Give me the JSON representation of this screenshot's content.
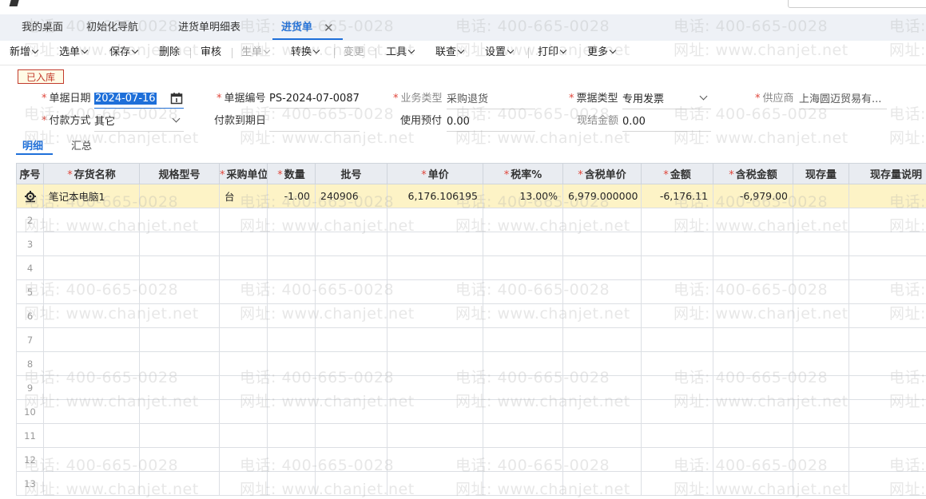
{
  "app": {
    "title_partial": "",
    "subtitle_partial": "",
    "date_partial": ""
  },
  "tabs": [
    {
      "label": "我的桌面"
    },
    {
      "label": "初始化导航"
    },
    {
      "label": "进货单明细表"
    },
    {
      "label": "进货单",
      "active": true
    }
  ],
  "toolbar": {
    "items": [
      {
        "label": "新增",
        "dropdown": true
      },
      {
        "label": "选单",
        "dropdown": true
      },
      {
        "label": "保存",
        "dropdown": true
      },
      {
        "label": "删除"
      },
      {
        "label": "审核"
      },
      {
        "label": "生单",
        "dropdown": true,
        "disabled": true
      },
      {
        "label": "转换",
        "dropdown": true
      },
      {
        "label": "变更",
        "disabled": true
      },
      {
        "label": "工具",
        "dropdown": true
      },
      {
        "label": "联查",
        "dropdown": true
      },
      {
        "label": "设置",
        "dropdown": true
      },
      {
        "label": "打印",
        "dropdown": true
      },
      {
        "label": "更多",
        "dropdown": true
      }
    ]
  },
  "status_badge": "已入库",
  "form": {
    "doc_date": {
      "label": "单据日期",
      "value": "2024-07-16"
    },
    "doc_no": {
      "label": "单据编号",
      "value": "PS-2024-07-0087"
    },
    "biz_type": {
      "label": "业务类型",
      "value": "采购退货"
    },
    "invoice_type": {
      "label": "票据类型",
      "value": "专用发票"
    },
    "supplier": {
      "label": "供应商",
      "value": "上海圆迈贸易有..."
    },
    "pay_method": {
      "label": "付款方式",
      "value": "其它"
    },
    "pay_due": {
      "label": "付款到期日",
      "value": ""
    },
    "prepay": {
      "label": "使用预付",
      "value": "0.00"
    },
    "cash_settle": {
      "label": "现结金额",
      "value": "0.00"
    }
  },
  "subtabs": [
    {
      "label": "明细",
      "active": true
    },
    {
      "label": "汇总"
    }
  ],
  "grid": {
    "columns": [
      {
        "label": "序号",
        "required": false
      },
      {
        "label": "存货名称",
        "required": true
      },
      {
        "label": "规格型号",
        "required": false
      },
      {
        "label": "采购单位",
        "required": true
      },
      {
        "label": "数量",
        "required": true
      },
      {
        "label": "批号",
        "required": false
      },
      {
        "label": "单价",
        "required": true
      },
      {
        "label": "税率%",
        "required": true
      },
      {
        "label": "含税单价",
        "required": true
      },
      {
        "label": "金额",
        "required": true
      },
      {
        "label": "含税金额",
        "required": true
      },
      {
        "label": "现存量",
        "required": false
      },
      {
        "label": "现存量说明",
        "required": false
      }
    ],
    "rows": [
      {
        "name": "笔记本电脑1",
        "spec": "",
        "unit": "台",
        "qty": "-1.00",
        "batch": "240906",
        "price": "6,176.106195",
        "tax_rate": "13.00%",
        "tax_price": "6,979.000000",
        "amount": "-6,176.11",
        "tax_amount": "-6,979.00",
        "stock": "",
        "stock_note": ""
      }
    ],
    "row_numbers": [
      "2",
      "3",
      "4",
      "5",
      "6",
      "7",
      "8",
      "9",
      "10",
      "11",
      "12",
      "13"
    ]
  },
  "watermark": {
    "phone": "电话: 400-665-0028",
    "site": "网址: www.chanjet.net"
  },
  "colors": {
    "accent": "#1e6fd9",
    "badge": "#c23a2c",
    "negative": "#d40000",
    "selected_row": "#fdf3c6"
  }
}
